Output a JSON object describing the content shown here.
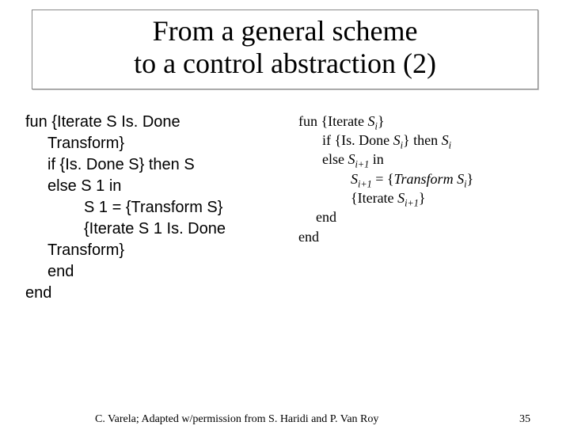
{
  "title": {
    "line1": "From a general scheme",
    "line2": "to a control abstraction (2)"
  },
  "left": {
    "l1": "fun {Iterate S Is. Done",
    "l2": "Transform}",
    "l3": "if {Is. Done S} then S",
    "l4": "else S 1 in",
    "l5": "S 1 = {Transform S}",
    "l6": "{Iterate S 1 Is. Done",
    "l7": "Transform}",
    "l8": "end",
    "l9": "end"
  },
  "right": {
    "l1_a": "fun {Iterate ",
    "l1_b": "S",
    "l1_sub": "i",
    "l1_c": "}",
    "l2_a": "if {Is. Done ",
    "l2_b": "S",
    "l2_sub": "i",
    "l2_c": "} then ",
    "l2_d": "S",
    "l2_sub2": "i",
    "l3_a": "else ",
    "l3_b": "S",
    "l3_sub": "i+1",
    "l3_c": " in",
    "l4_a": "S",
    "l4_sub": "i+1",
    "l4_b": " = {",
    "l4_c": "Transform S",
    "l4_sub2": "i",
    "l4_d": "}",
    "l5_a": "{Iterate ",
    "l5_b": "S",
    "l5_sub": "i+1",
    "l5_c": "}",
    "l6": "end",
    "l7": "end"
  },
  "footer": {
    "credit": "C. Varela; Adapted w/permission from S. Haridi and P. Van Roy",
    "page": "35"
  }
}
